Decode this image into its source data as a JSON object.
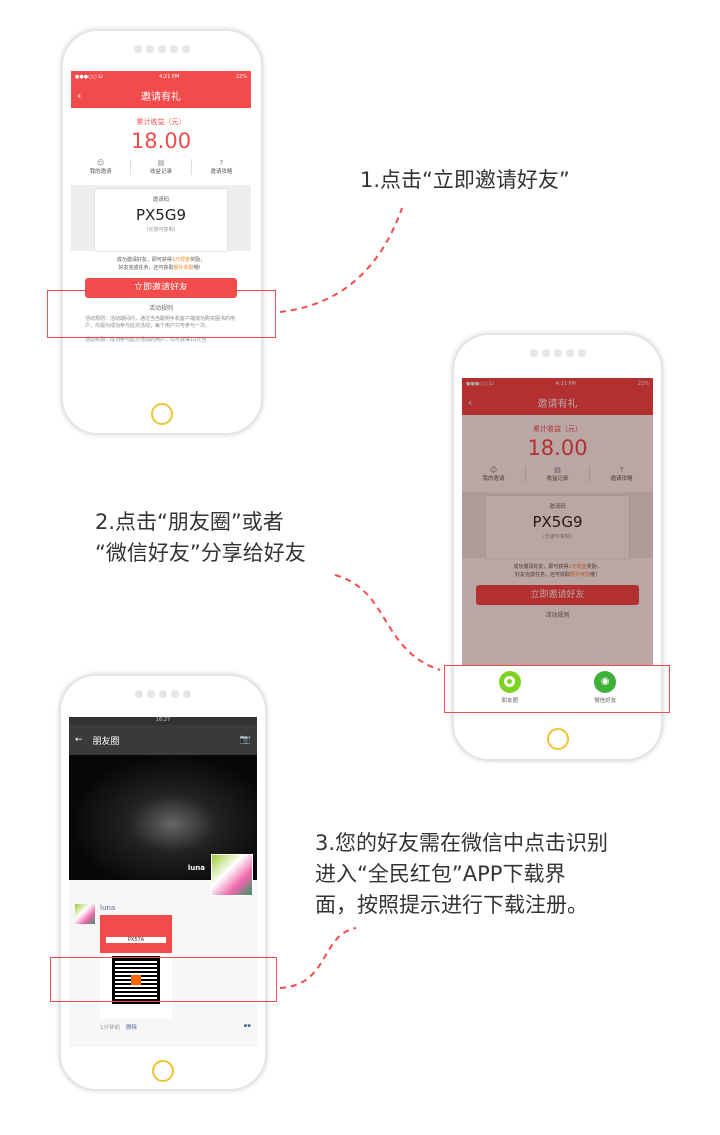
{
  "app_screen": {
    "status_time": "4:21 PM",
    "status_carrier": "●●●○○ Li",
    "status_battery": "22%",
    "title": "邀请有礼",
    "earnings_label": "累计收益（元）",
    "earnings_value": "18.00",
    "tabs": [
      "我的邀请",
      "收益记录",
      "邀请攻略"
    ],
    "code_label": "邀请码",
    "code_value": "PX5G9",
    "code_hint": "(长按可复制)",
    "tip_line1_a": "成功邀请好友，即可获得",
    "tip_line1_b": "1元现金",
    "tip_line1_c": "奖励，",
    "tip_line2_a": "好友完成任务，还可获取",
    "tip_line2_b": "额外奖励",
    "tip_line2_c": "哦！",
    "invite_button": "立即邀请好友",
    "rules_title": "活动规则",
    "rules_text1": "活动规则：活动期间内，通过当当聪明手机客户端成功购买图书的用户，均视为成功参与此次活动；每个用户只可参与一次。",
    "rules_text2": "活动奖励：成功参与此次活动的用户，均可获得10元当"
  },
  "share_sheet": {
    "items": [
      "朋友圈",
      "微信好友"
    ]
  },
  "moments_screen": {
    "status_time": "16:27",
    "title": "朋友圈",
    "cover_name": "luna",
    "post_user": "luna",
    "post_code": "PX57A",
    "post_time": "1分钟前",
    "post_delete": "删除"
  },
  "steps": {
    "step1": "1.点击“立即邀请好友”",
    "step2_line1": "2.点击“朋友圈”或者",
    "step2_line2": "“微信好友”分享给好友",
    "step3_line1": "3.您的好友需在微信中点击识别",
    "step3_line2": "进入“全民红包”APP下载界",
    "step3_line3": "面，按照提示进行下载注册。"
  },
  "colors": {
    "accent": "#f24b4b",
    "wechat_green": "#3fb13a"
  }
}
